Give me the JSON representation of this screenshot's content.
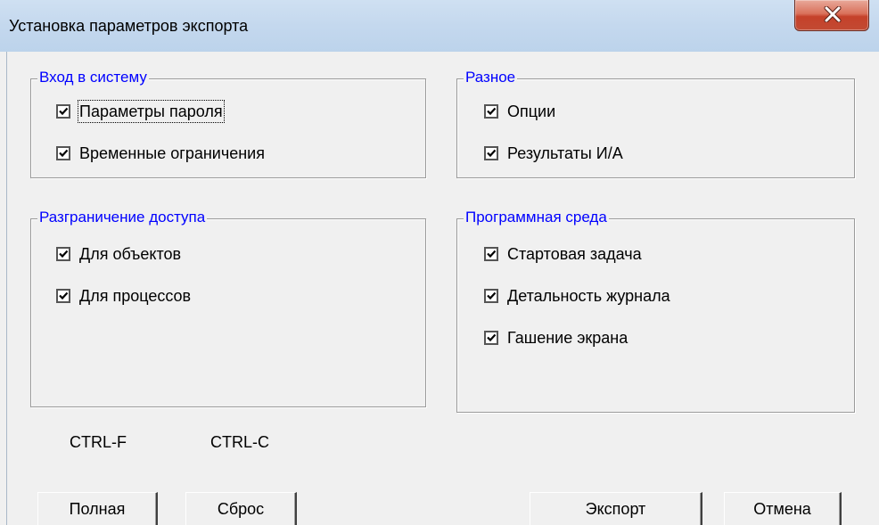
{
  "window": {
    "title": "Установка параметров экспорта",
    "close_icon": "close-x-icon"
  },
  "groups": {
    "login": {
      "title": "Вход в систему",
      "items": [
        {
          "label": "Параметры пароля",
          "checked": true
        },
        {
          "label": "Временные ограничения",
          "checked": true
        }
      ]
    },
    "misc": {
      "title": "Разное",
      "items": [
        {
          "label": "Опции",
          "checked": true
        },
        {
          "label": "Результаты И/А",
          "checked": true
        }
      ]
    },
    "access": {
      "title": "Разграничение доступа",
      "items": [
        {
          "label": "Для объектов",
          "checked": true
        },
        {
          "label": "Для процессов",
          "checked": true
        }
      ]
    },
    "env": {
      "title": "Программная среда",
      "items": [
        {
          "label": "Стартовая задача",
          "checked": true
        },
        {
          "label": "Детальность журнала",
          "checked": true
        },
        {
          "label": "Гашение экрана",
          "checked": true
        }
      ]
    }
  },
  "shortcuts": {
    "full": "CTRL-F",
    "reset": "CTRL-C"
  },
  "buttons": {
    "full": "Полная",
    "reset": "Сброс",
    "export": "Экспорт",
    "cancel": "Отмена"
  },
  "colors": {
    "group_title": "#0000ff",
    "titlebar": "#c4d8ee",
    "close_button": "#c5412a",
    "dialog_bg": "#f0f0f0"
  }
}
